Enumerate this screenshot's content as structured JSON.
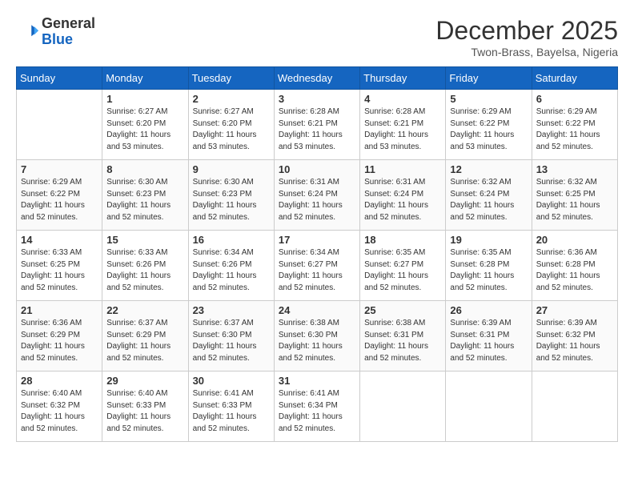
{
  "header": {
    "logo_general": "General",
    "logo_blue": "Blue",
    "month_title": "December 2025",
    "location": "Twon-Brass, Bayelsa, Nigeria"
  },
  "days_of_week": [
    "Sunday",
    "Monday",
    "Tuesday",
    "Wednesday",
    "Thursday",
    "Friday",
    "Saturday"
  ],
  "weeks": [
    [
      {
        "day": "",
        "info": ""
      },
      {
        "day": "1",
        "info": "Sunrise: 6:27 AM\nSunset: 6:20 PM\nDaylight: 11 hours\nand 53 minutes."
      },
      {
        "day": "2",
        "info": "Sunrise: 6:27 AM\nSunset: 6:20 PM\nDaylight: 11 hours\nand 53 minutes."
      },
      {
        "day": "3",
        "info": "Sunrise: 6:28 AM\nSunset: 6:21 PM\nDaylight: 11 hours\nand 53 minutes."
      },
      {
        "day": "4",
        "info": "Sunrise: 6:28 AM\nSunset: 6:21 PM\nDaylight: 11 hours\nand 53 minutes."
      },
      {
        "day": "5",
        "info": "Sunrise: 6:29 AM\nSunset: 6:22 PM\nDaylight: 11 hours\nand 53 minutes."
      },
      {
        "day": "6",
        "info": "Sunrise: 6:29 AM\nSunset: 6:22 PM\nDaylight: 11 hours\nand 52 minutes."
      }
    ],
    [
      {
        "day": "7",
        "info": "Sunrise: 6:29 AM\nSunset: 6:22 PM\nDaylight: 11 hours\nand 52 minutes."
      },
      {
        "day": "8",
        "info": "Sunrise: 6:30 AM\nSunset: 6:23 PM\nDaylight: 11 hours\nand 52 minutes."
      },
      {
        "day": "9",
        "info": "Sunrise: 6:30 AM\nSunset: 6:23 PM\nDaylight: 11 hours\nand 52 minutes."
      },
      {
        "day": "10",
        "info": "Sunrise: 6:31 AM\nSunset: 6:24 PM\nDaylight: 11 hours\nand 52 minutes."
      },
      {
        "day": "11",
        "info": "Sunrise: 6:31 AM\nSunset: 6:24 PM\nDaylight: 11 hours\nand 52 minutes."
      },
      {
        "day": "12",
        "info": "Sunrise: 6:32 AM\nSunset: 6:24 PM\nDaylight: 11 hours\nand 52 minutes."
      },
      {
        "day": "13",
        "info": "Sunrise: 6:32 AM\nSunset: 6:25 PM\nDaylight: 11 hours\nand 52 minutes."
      }
    ],
    [
      {
        "day": "14",
        "info": "Sunrise: 6:33 AM\nSunset: 6:25 PM\nDaylight: 11 hours\nand 52 minutes."
      },
      {
        "day": "15",
        "info": "Sunrise: 6:33 AM\nSunset: 6:26 PM\nDaylight: 11 hours\nand 52 minutes."
      },
      {
        "day": "16",
        "info": "Sunrise: 6:34 AM\nSunset: 6:26 PM\nDaylight: 11 hours\nand 52 minutes."
      },
      {
        "day": "17",
        "info": "Sunrise: 6:34 AM\nSunset: 6:27 PM\nDaylight: 11 hours\nand 52 minutes."
      },
      {
        "day": "18",
        "info": "Sunrise: 6:35 AM\nSunset: 6:27 PM\nDaylight: 11 hours\nand 52 minutes."
      },
      {
        "day": "19",
        "info": "Sunrise: 6:35 AM\nSunset: 6:28 PM\nDaylight: 11 hours\nand 52 minutes."
      },
      {
        "day": "20",
        "info": "Sunrise: 6:36 AM\nSunset: 6:28 PM\nDaylight: 11 hours\nand 52 minutes."
      }
    ],
    [
      {
        "day": "21",
        "info": "Sunrise: 6:36 AM\nSunset: 6:29 PM\nDaylight: 11 hours\nand 52 minutes."
      },
      {
        "day": "22",
        "info": "Sunrise: 6:37 AM\nSunset: 6:29 PM\nDaylight: 11 hours\nand 52 minutes."
      },
      {
        "day": "23",
        "info": "Sunrise: 6:37 AM\nSunset: 6:30 PM\nDaylight: 11 hours\nand 52 minutes."
      },
      {
        "day": "24",
        "info": "Sunrise: 6:38 AM\nSunset: 6:30 PM\nDaylight: 11 hours\nand 52 minutes."
      },
      {
        "day": "25",
        "info": "Sunrise: 6:38 AM\nSunset: 6:31 PM\nDaylight: 11 hours\nand 52 minutes."
      },
      {
        "day": "26",
        "info": "Sunrise: 6:39 AM\nSunset: 6:31 PM\nDaylight: 11 hours\nand 52 minutes."
      },
      {
        "day": "27",
        "info": "Sunrise: 6:39 AM\nSunset: 6:32 PM\nDaylight: 11 hours\nand 52 minutes."
      }
    ],
    [
      {
        "day": "28",
        "info": "Sunrise: 6:40 AM\nSunset: 6:32 PM\nDaylight: 11 hours\nand 52 minutes."
      },
      {
        "day": "29",
        "info": "Sunrise: 6:40 AM\nSunset: 6:33 PM\nDaylight: 11 hours\nand 52 minutes."
      },
      {
        "day": "30",
        "info": "Sunrise: 6:41 AM\nSunset: 6:33 PM\nDaylight: 11 hours\nand 52 minutes."
      },
      {
        "day": "31",
        "info": "Sunrise: 6:41 AM\nSunset: 6:34 PM\nDaylight: 11 hours\nand 52 minutes."
      },
      {
        "day": "",
        "info": ""
      },
      {
        "day": "",
        "info": ""
      },
      {
        "day": "",
        "info": ""
      }
    ]
  ]
}
